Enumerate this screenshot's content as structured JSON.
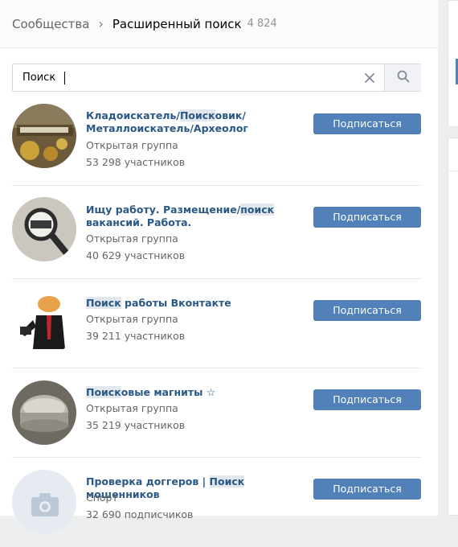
{
  "breadcrumb": {
    "parent": "Сообщества",
    "separator": "›",
    "current": "Расширенный поиск",
    "count": "4 824"
  },
  "search": {
    "value": "Поиск",
    "placeholder": ""
  },
  "subscribe_label": "Подписаться",
  "results": [
    {
      "name_parts": [
        "Кладоискатель/",
        "Поиск",
        "овик/ Металлоискатель/Археолог"
      ],
      "type": "Открытая группа",
      "members": "53 298 участников"
    },
    {
      "name_parts": [
        "Ищу работу. Размещение/",
        "поиск",
        " вакансий. Работа."
      ],
      "type": "Открытая группа",
      "members": "40 629 участников"
    },
    {
      "name_parts": [
        "",
        "Поиск",
        " работы Вконтакте"
      ],
      "type": "Открытая группа",
      "members": "39 211 участников"
    },
    {
      "name_parts": [
        "",
        "Поиск",
        "овые магниты ☆"
      ],
      "type": "Открытая группа",
      "members": "35 219 участников"
    },
    {
      "name_parts": [
        "Проверка доггеров | ",
        "Поиск",
        " мошенников"
      ],
      "type": "Спорт",
      "members": "32 690 подписчиков"
    }
  ],
  "colors": {
    "link": "#2a5885",
    "button": "#5181b8",
    "highlight": "#e1e7ed",
    "page_bg": "#edeef0"
  }
}
